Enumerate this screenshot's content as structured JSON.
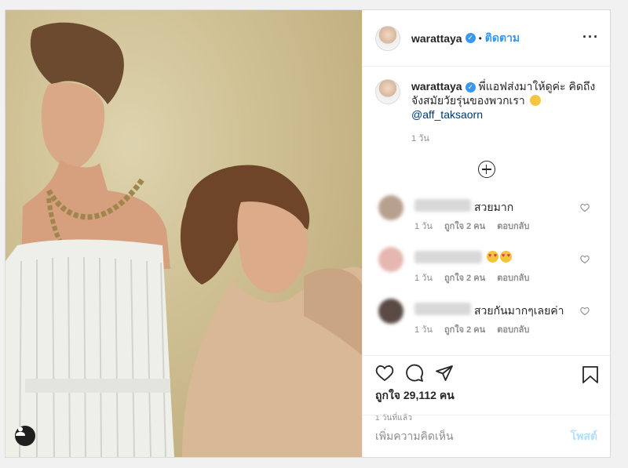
{
  "post": {
    "username": "warattaya",
    "follow_label": "ติดตาม",
    "more_icon": "more-horizontal-icon"
  },
  "caption": {
    "username": "warattaya",
    "text": "พี่แอฟส่งมาให้ดูค่ะ คิดถึงจังสมัยวัยรุ่นของพวกเรา",
    "mention": "@aff_taksaorn",
    "time": "1 วัน"
  },
  "comments": [
    {
      "text": "สวยมาก",
      "time": "1 วัน",
      "likes": "ถูกใจ 2 คน",
      "reply": "ตอบกลับ"
    },
    {
      "text": "",
      "time": "1 วัน",
      "likes": "ถูกใจ 2 คน",
      "reply": "ตอบกลับ"
    },
    {
      "text": "สวยกันมากๆเลยค่า",
      "time": "1 วัน",
      "likes": "ถูกใจ 2 คน",
      "reply": "ตอบกลับ"
    }
  ],
  "stats": {
    "likes": "ถูกใจ 29,112 คน",
    "posted": "1 วันที่แล้ว"
  },
  "composer": {
    "placeholder": "เพิ่มความคิดเห็น",
    "post_label": "โพสต์"
  },
  "colors": {
    "accent": "#3897f0",
    "post_disabled": "#b2dffc"
  }
}
